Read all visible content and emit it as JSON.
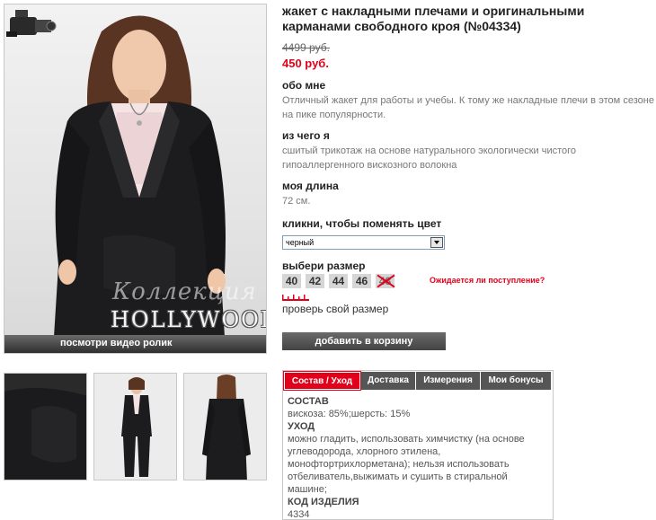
{
  "product": {
    "title": "жакет с накладными плечами и оригинальными карманами свободного кроя (№04334)",
    "old_price": "4499 руб.",
    "new_price": "450 руб."
  },
  "about": {
    "heading": "обо мне",
    "text": "Отличный жакет для работы и учебы. К тому же накладные плечи в этом сезоне на пике популярности."
  },
  "material": {
    "heading": "из чего я",
    "text": "сшитый трикотаж на основе натурального экологически чистого гипоаллергенного вискозного волокна"
  },
  "length": {
    "heading": "моя длина",
    "value": "72 см."
  },
  "color": {
    "heading": "кликни, чтобы поменять цвет",
    "selected": "черный"
  },
  "size": {
    "heading": "выбери размер",
    "options": [
      {
        "label": "40",
        "available": true
      },
      {
        "label": "42",
        "available": true
      },
      {
        "label": "44",
        "available": true
      },
      {
        "label": "46",
        "available": true
      },
      {
        "label": "48",
        "available": false
      }
    ],
    "await_link": "Ожидается ли поступление?",
    "check_size": "проверь свой размер"
  },
  "cart": {
    "button": "добавить в корзину"
  },
  "photo": {
    "watermark_small": "Коллекция",
    "watermark_big": "HOLLYWOOD",
    "video_label": "посмотри видео ролик"
  },
  "tabs": {
    "items": [
      "Состав / Уход",
      "Доставка",
      "Измерения",
      "Мои бонусы"
    ],
    "active": 0,
    "content": {
      "composition_heading": "СОСТАВ",
      "composition": "вискоза: 85%;шерсть: 15%",
      "care_heading": "УХОД",
      "care": "можно гладить, использовать химчистку (на основе углеводорода, хлорного этилена, монофтортрихлорметана); нельзя использовать отбеливатель,выжимать и сушить в стиральной машине;",
      "code_heading": "КОД ИЗДЕЛИЯ",
      "code": "4334"
    }
  },
  "colors": {
    "accent": "#e2001a",
    "button": "#555555",
    "text": "#333333"
  }
}
